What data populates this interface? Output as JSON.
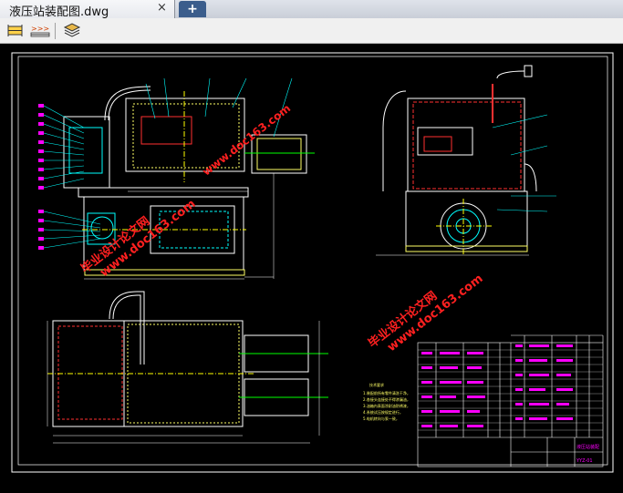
{
  "tab": {
    "title": "液压站装配图.dwg",
    "close_glyph": "×",
    "new_tab_glyph": "+"
  },
  "toolbar": {
    "buttons": [
      "measure-icon",
      "dimension-icon",
      "layers-icon"
    ]
  },
  "drawing": {
    "drawing_number": "YYZ-01",
    "title_block_name": "液压站装配",
    "notes_title": "技术要求",
    "notes": [
      "1.装配前所有零件清洗干净，",
      "2.各接头连接处不得渗漏油，",
      "3.油箱内表面涂耐油防锈漆，",
      "4.系统试压按规定进行，",
      "5.电机转向与泵一致，"
    ]
  },
  "watermarks": [
    {
      "line1": "毕业设计论文网",
      "line2": "www.doc163.com"
    },
    {
      "line1": "毕业设计论文网",
      "line2": "www.doc163.com"
    },
    {
      "line1": "毕业设计论文网",
      "line2": "www.doc163.com"
    }
  ]
}
